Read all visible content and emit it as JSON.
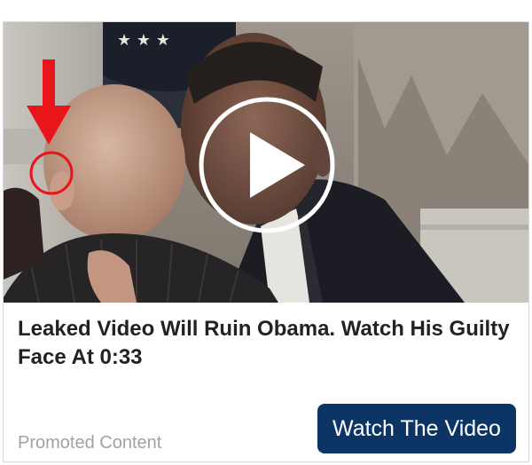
{
  "ad": {
    "headline": "Leaked Video Will Ruin Obama. Watch His Guilty Face At 0:33",
    "promoted_label": "Promoted Content",
    "cta_label": "Watch The Video"
  },
  "colors": {
    "cta_background": "#0c3465",
    "marker_red": "#e8161b",
    "headline_text": "#222222",
    "promoted_text": "#a2a2a2"
  },
  "icons": {
    "play": "play-icon",
    "arrow": "arrow-down-icon",
    "marker": "circle-marker-icon"
  }
}
